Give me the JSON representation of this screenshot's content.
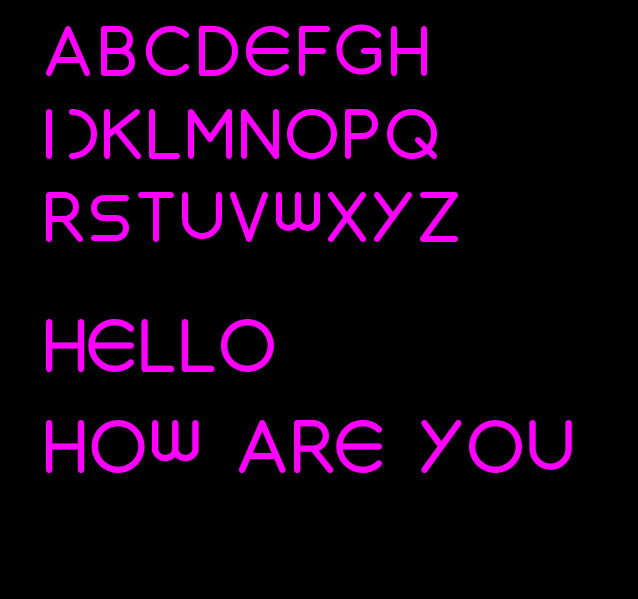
{
  "specimen": {
    "alphabet_lines": [
      "ABCDEFGH",
      "IJKLMNOPQ",
      "RSTUVWXYZ"
    ],
    "sample_lines": [
      "HELLO",
      "HOW ARE YOU"
    ]
  },
  "colors": {
    "background": "#000000",
    "glyph": "#FF00FF"
  }
}
